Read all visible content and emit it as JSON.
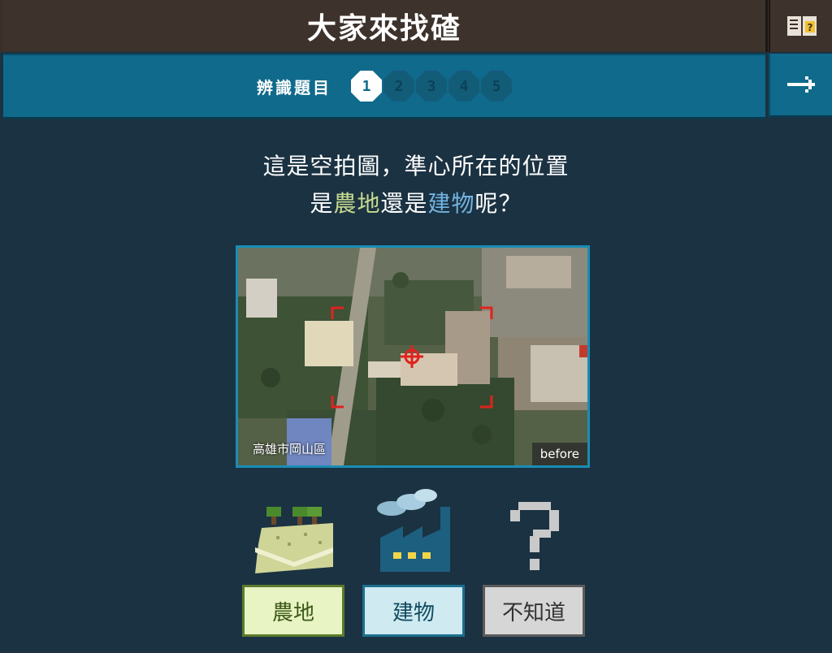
{
  "header": {
    "title": "大家來找碴",
    "guide_icon": "book-icon"
  },
  "nav": {
    "label": "辨識題目",
    "steps": [
      "1",
      "2",
      "3",
      "4",
      "5"
    ],
    "active_step": "1",
    "next_icon": "arrow-right-icon"
  },
  "question": {
    "line1": "這是空拍圖，準心所在的位置",
    "line2_prefix": "是",
    "keyword_farm": "農地",
    "line2_mid": "還是",
    "keyword_building": "建物",
    "line2_suffix": "呢？"
  },
  "map": {
    "place": "高雄市岡山區",
    "tag": "before"
  },
  "options": {
    "farm_label": "農地",
    "building_label": "建物",
    "unknown_label": "不知道"
  },
  "colors": {
    "farm_accent": "#c5d98f",
    "building_accent": "#72b3e0",
    "crosshair": "#e0231e"
  }
}
